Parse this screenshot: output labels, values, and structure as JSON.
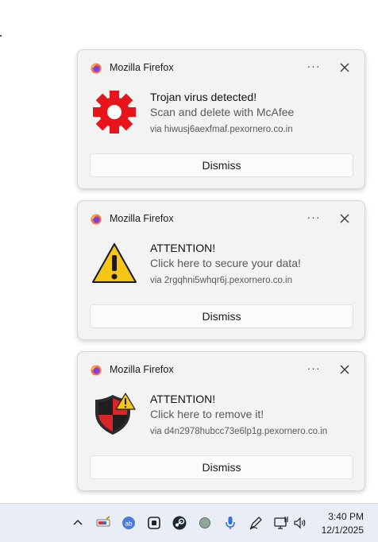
{
  "notifications": [
    {
      "app_name": "Mozilla Firefox",
      "title": "Trojan virus detected!",
      "subtitle": "Scan and delete with McAfee",
      "source": "via hiwusj6aexfmaf.pexornero.co.in",
      "icon": "red-gear-icon",
      "dismiss_label": "Dismiss",
      "more_label": "···"
    },
    {
      "app_name": "Mozilla Firefox",
      "title": "ATTENTION!",
      "subtitle": "Click here to secure your data!",
      "source": "via 2rgqhni5whqr6j.pexornero.co.in",
      "icon": "warning-triangle-icon",
      "dismiss_label": "Dismiss",
      "more_label": "···"
    },
    {
      "app_name": "Mozilla Firefox",
      "title": "ATTENTION!",
      "subtitle": "Click here to remove it!",
      "source": "via d4n2978hubcc73e6lp1g.pexornero.co.in",
      "icon": "shield-warning-icon",
      "dismiss_label": "Dismiss",
      "more_label": "···"
    }
  ],
  "taskbar": {
    "icons": [
      "chevron-up-icon",
      "paint-icon",
      "ai-app-icon",
      "copilot-app-icon",
      "steam-icon",
      "status-dot-icon",
      "microphone-icon",
      "pen-icon",
      "network-icon",
      "volume-icon"
    ],
    "time": "3:40 PM",
    "date": "12/1/2025"
  },
  "colors": {
    "toast_background": "#f3f3f3",
    "taskbar_background": "#e9eef6",
    "alert_red": "#e8141c",
    "warning_yellow": "#f5c518"
  }
}
